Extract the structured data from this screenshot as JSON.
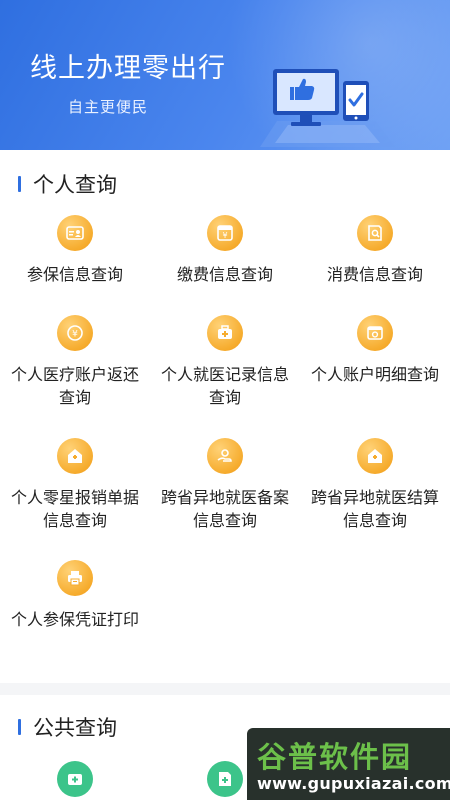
{
  "banner": {
    "title": "线上办理零出行",
    "subtitle": "自主更便民"
  },
  "personal": {
    "title": "个人查询",
    "items": [
      {
        "label": "参保信息查询",
        "icon": "id-card-icon"
      },
      {
        "label": "缴费信息查询",
        "icon": "yen-payment-icon"
      },
      {
        "label": "消费信息查询",
        "icon": "receipt-search-icon"
      },
      {
        "label": "个人医疗账户返还查询",
        "icon": "refund-icon"
      },
      {
        "label": "个人就医记录信息查询",
        "icon": "medical-kit-icon"
      },
      {
        "label": "个人账户明细查询",
        "icon": "account-detail-icon"
      },
      {
        "label": "个人零星报销单据信息查询",
        "icon": "home-reimburse-icon"
      },
      {
        "label": "跨省异地就医备案信息查询",
        "icon": "location-hand-icon"
      },
      {
        "label": "跨省异地就医结算信息查询",
        "icon": "home-settle-icon"
      },
      {
        "label": "个人参保凭证打印",
        "icon": "print-certificate-icon"
      }
    ]
  },
  "public": {
    "title": "公共查询",
    "items": [
      {
        "icon": "medical-institution-icon",
        "color": "#3cc48a"
      },
      {
        "icon": "document-plus-icon",
        "color": "#3cc48a"
      }
    ]
  },
  "watermark": {
    "name": "谷普软件园",
    "url": "www.gupuxiazai.com"
  },
  "colors": {
    "accent": "#2f6fe0",
    "icon_orange": "#f6ac2e",
    "icon_green": "#3cc48a"
  }
}
